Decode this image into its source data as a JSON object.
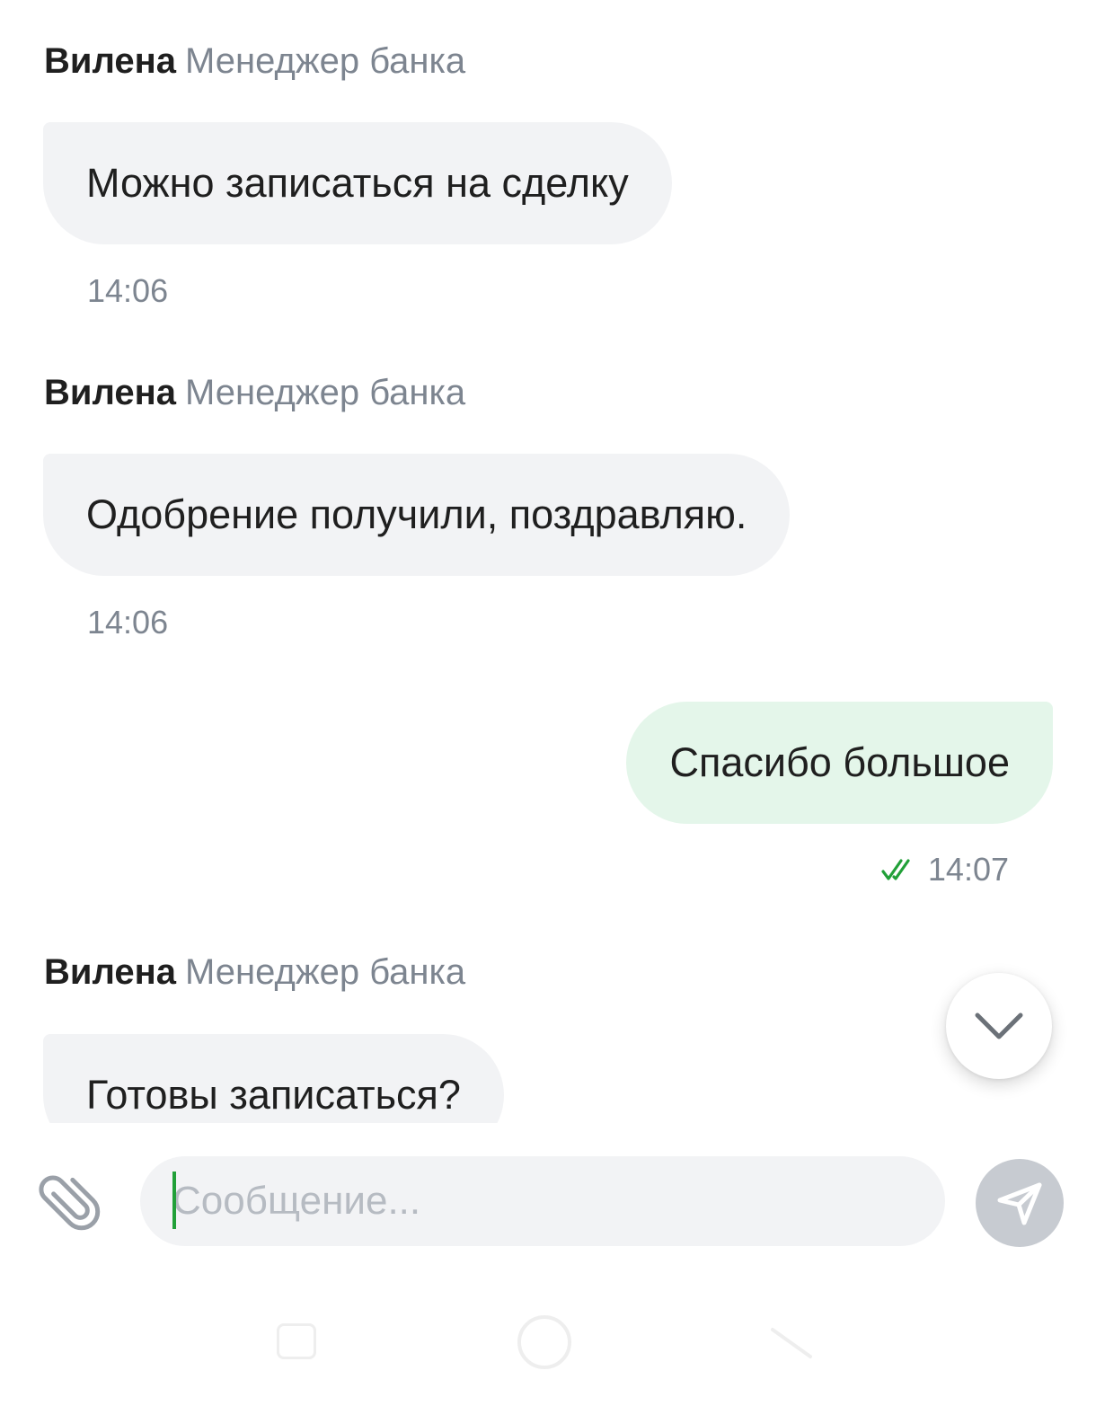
{
  "messages": [
    {
      "sender_name": "Вилена",
      "sender_role": "Менеджер банка",
      "text": "Можно записаться на сделку",
      "time": "14:06"
    },
    {
      "sender_name": "Вилена",
      "sender_role": "Менеджер банка",
      "text": "Одобрение получили, поздравляю.",
      "time": "14:06"
    },
    {
      "text": "Спасибо большое",
      "time": "14:07",
      "status_icon": "double-check-icon",
      "status_color": "#21a038"
    },
    {
      "sender_name": "Вилена",
      "sender_role": "Менеджер банка",
      "text": "Готовы записаться?"
    }
  ],
  "composer": {
    "placeholder": "Сообщение...",
    "value": "",
    "attach_icon": "paperclip-icon",
    "send_icon": "send-icon"
  },
  "scroll_down_icon": "chevron-down-icon",
  "colors": {
    "incoming_bubble": "#f2f3f5",
    "outgoing_bubble": "#e4f6ea",
    "accent": "#21a038",
    "secondary_text": "#7d8590",
    "send_button_disabled": "#c7cbd1"
  }
}
